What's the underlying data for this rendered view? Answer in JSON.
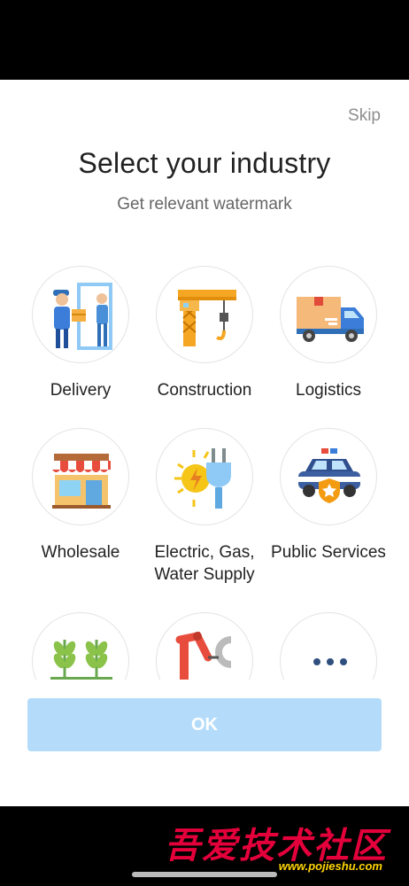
{
  "header": {
    "skip_label": "Skip",
    "title": "Select your industry",
    "subtitle": "Get relevant watermark"
  },
  "industries": [
    {
      "label": "Delivery",
      "icon": "delivery-icon"
    },
    {
      "label": "Construction",
      "icon": "construction-crane-icon"
    },
    {
      "label": "Logistics",
      "icon": "delivery-truck-icon"
    },
    {
      "label": "Wholesale",
      "icon": "storefront-icon"
    },
    {
      "label": "Electric, Gas, Water Supply",
      "icon": "power-plug-icon"
    },
    {
      "label": "Public Services",
      "icon": "police-car-icon"
    },
    {
      "label": "",
      "icon": "wheat-icon"
    },
    {
      "label": "",
      "icon": "robotic-arm-icon"
    },
    {
      "label": "",
      "icon": "more-dots-icon"
    }
  ],
  "footer": {
    "ok_label": "OK"
  },
  "overlay": {
    "watermark_text": "吾爱技术社区",
    "watermark_url": "www.pojieshu.com"
  },
  "colors": {
    "ok_button_bg": "#b4dcfa",
    "watermark_red": "#e3003b",
    "watermark_yellow": "#ffd400"
  }
}
